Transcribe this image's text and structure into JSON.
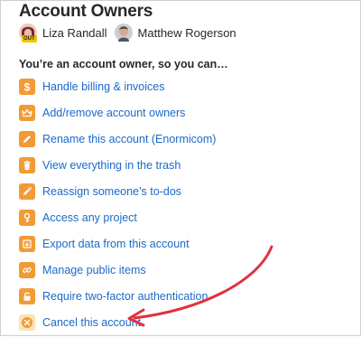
{
  "title": "Account Owners",
  "owners": [
    {
      "name": "Liza Randall",
      "badge": "OUT"
    },
    {
      "name": "Matthew Rogerson"
    }
  ],
  "lead": "You’re an account owner, so you can…",
  "items": [
    {
      "label": "Handle billing & invoices",
      "icon": "dollar-icon"
    },
    {
      "label": "Add/remove account owners",
      "icon": "crown-icon"
    },
    {
      "label": "Rename this account (Enormicom)",
      "icon": "pencil-icon"
    },
    {
      "label": "View everything in the trash",
      "icon": "trash-icon"
    },
    {
      "label": "Reassign someone’s to-dos",
      "icon": "reassign-icon"
    },
    {
      "label": "Access any project",
      "icon": "key-icon"
    },
    {
      "label": "Export data from this account",
      "icon": "export-icon"
    },
    {
      "label": "Manage public items",
      "icon": "link-icon"
    },
    {
      "label": "Require two-factor authentication",
      "icon": "lock-icon"
    },
    {
      "label": "Cancel this account",
      "icon": "cancel-icon"
    }
  ],
  "colors": {
    "accent": "#f29b34",
    "link": "#1b6ac9",
    "annotation_arrow": "#e0313f"
  }
}
